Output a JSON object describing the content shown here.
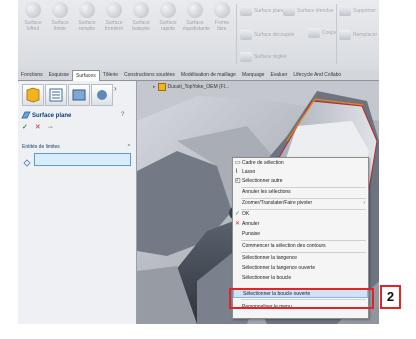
{
  "ribbon": {
    "buttons": [
      {
        "label": "Surface lofted",
        "icon": "surface-loft-icon"
      },
      {
        "label": "Surface limite",
        "icon": "surface-boundary-icon"
      },
      {
        "label": "Surface remplie",
        "icon": "surface-fill-icon"
      },
      {
        "label": "Surface frontière",
        "icon": "surface-frontier-icon"
      },
      {
        "label": "Surface balayée",
        "icon": "surface-sweep-icon"
      },
      {
        "label": "Surface rapide",
        "icon": "surface-quick-icon"
      },
      {
        "label": "Surface équidistante",
        "icon": "surface-offset-icon"
      },
      {
        "label": "Forme libre",
        "icon": "freeform-icon"
      }
    ],
    "small": [
      {
        "label": "Surface plane",
        "icon": "surface-plane-icon"
      },
      {
        "label": "Surface découpée",
        "icon": "surface-trim-icon"
      },
      {
        "label": "Surface réglée",
        "icon": "ruled-surface-icon"
      },
      {
        "label": "Surface étendue",
        "icon": "extend-surface-icon"
      },
      {
        "label": "Coupe",
        "icon": "cut-icon"
      },
      {
        "label": "Supprimer",
        "icon": "delete-icon"
      },
      {
        "label": "Remplacer",
        "icon": "replace-icon"
      }
    ]
  },
  "tabs": [
    "Fonctions",
    "Esquisse",
    "Surfaces",
    "Tôlerie",
    "Constructions soudées",
    "Modélisation de maillage",
    "Marquage",
    "Evaluer",
    "Lifecycle And Collabo"
  ],
  "active_tab": "Surfaces",
  "panel": {
    "title": "Surface plane",
    "ok": "✓",
    "cancel": "✕",
    "section_label": "Entités de limites",
    "field_value": ""
  },
  "viewport": {
    "tree_label": "Ducati_TopYoke_OEM (Fl..."
  },
  "menu": {
    "items": [
      {
        "label": "Cadre de sélection",
        "icon": "box-select-icon"
      },
      {
        "label": "Lasso",
        "icon": "lasso-icon"
      },
      {
        "label": "Sélectionner autre",
        "icon": "select-other-icon"
      },
      {
        "label": "Annuler les sélections",
        "icon": ""
      },
      {
        "label": "Zoomer/Translater/Faire pivoter",
        "icon": ""
      },
      {
        "label": "OK",
        "icon": "check-icon"
      },
      {
        "label": "Annuler",
        "icon": "cross-icon"
      },
      {
        "label": "Punaise",
        "icon": ""
      },
      {
        "label": "Commencer la sélection des contours",
        "icon": ""
      },
      {
        "label": "Sélectionner la tangence",
        "icon": ""
      },
      {
        "label": "Sélectionner la tangence ouverte",
        "icon": ""
      },
      {
        "label": "Sélectionner la boucle",
        "icon": ""
      },
      {
        "label": "Sélectionner la boucle ouverte",
        "icon": ""
      },
      {
        "label": "Personnaliser le menu",
        "icon": ""
      }
    ],
    "submenu_arrow": "›",
    "highlighted": "Sélectionner la boucle ouverte"
  },
  "callout": {
    "number": "2"
  },
  "colors": {
    "accent": "#e0242a",
    "highlight": "#cfe3f7",
    "orange_edge": "#e8821e"
  }
}
